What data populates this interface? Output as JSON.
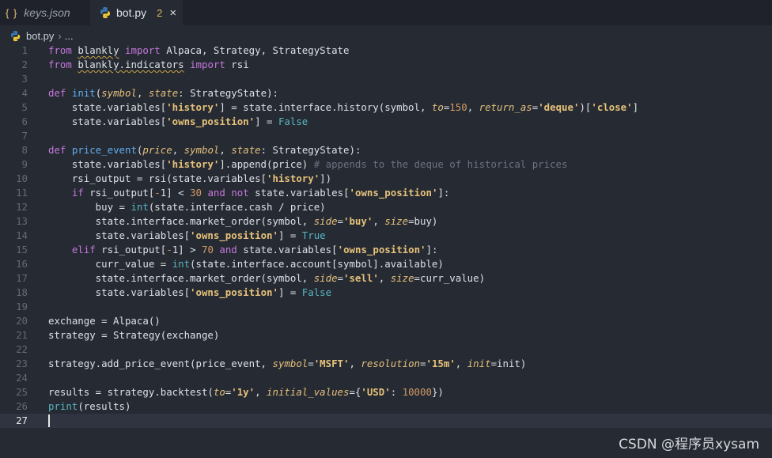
{
  "tabs": [
    {
      "icon": "json-braces-icon",
      "icon_text": "{ }",
      "label": "keys.json"
    },
    {
      "icon": "python-icon",
      "label": "bot.py",
      "badge": "2",
      "close": "×"
    }
  ],
  "breadcrumb": {
    "file": "bot.py",
    "separator": "›",
    "more": "..."
  },
  "colors": {
    "background": "#262a33",
    "keyword": "#c678dd",
    "function": "#61afef",
    "param": "#e5c07b",
    "number": "#d19a66",
    "comment": "#6b7280"
  },
  "editor": {
    "active_line": 27,
    "lines": [
      [
        [
          "from",
          "k"
        ],
        [
          " "
        ],
        [
          "blankly",
          "sq"
        ],
        [
          " "
        ],
        [
          "import",
          "k"
        ],
        [
          " Alpaca, Strategy, StrategyState"
        ]
      ],
      [
        [
          "from",
          "k"
        ],
        [
          " "
        ],
        [
          "blankly.indicators",
          "sq"
        ],
        [
          " "
        ],
        [
          "import",
          "k"
        ],
        [
          " rsi"
        ]
      ],
      [],
      [
        [
          "def",
          "k"
        ],
        [
          " "
        ],
        [
          "init",
          "f"
        ],
        [
          "("
        ],
        [
          "symbol",
          "p"
        ],
        [
          ", "
        ],
        [
          "state",
          "p"
        ],
        [
          ": StrategyState):"
        ]
      ],
      [
        [
          "    state.variables["
        ],
        [
          "'history'",
          "s"
        ],
        [
          "] = state.interface.history(symbol, "
        ],
        [
          "to",
          "p"
        ],
        [
          "="
        ],
        [
          "150",
          "n"
        ],
        [
          ", "
        ],
        [
          "return_as",
          "p"
        ],
        [
          "="
        ],
        [
          "'deque'",
          "s"
        ],
        [
          ")["
        ],
        [
          "'close'",
          "s"
        ],
        [
          "]"
        ]
      ],
      [
        [
          "    state.variables["
        ],
        [
          "'owns_position'",
          "s"
        ],
        [
          "] = "
        ],
        [
          "False",
          "b"
        ]
      ],
      [],
      [
        [
          "def",
          "k"
        ],
        [
          " "
        ],
        [
          "price_event",
          "f"
        ],
        [
          "("
        ],
        [
          "price",
          "p"
        ],
        [
          ", "
        ],
        [
          "symbol",
          "p"
        ],
        [
          ", "
        ],
        [
          "state",
          "p"
        ],
        [
          ": StrategyState):"
        ]
      ],
      [
        [
          "    state.variables["
        ],
        [
          "'history'",
          "s"
        ],
        [
          "].append(price) "
        ],
        [
          "# appends to the deque of historical prices",
          "c"
        ]
      ],
      [
        [
          "    rsi_output = rsi(state.variables["
        ],
        [
          "'history'",
          "s"
        ],
        [
          "])"
        ]
      ],
      [
        [
          "    "
        ],
        [
          "if",
          "k"
        ],
        [
          " rsi_output["
        ],
        [
          "-",
          "n"
        ],
        [
          "1] < "
        ],
        [
          "30",
          "n"
        ],
        [
          " "
        ],
        [
          "and",
          "k"
        ],
        [
          " "
        ],
        [
          "not",
          "k"
        ],
        [
          " state.variables["
        ],
        [
          "'owns_position'",
          "s"
        ],
        [
          "]:"
        ]
      ],
      [
        [
          "        buy = "
        ],
        [
          "int",
          "b"
        ],
        [
          "(state.interface.cash / price)"
        ]
      ],
      [
        [
          "        state.interface.market_order(symbol, "
        ],
        [
          "side",
          "p"
        ],
        [
          "="
        ],
        [
          "'buy'",
          "s"
        ],
        [
          ", "
        ],
        [
          "size",
          "p"
        ],
        [
          "=buy)"
        ]
      ],
      [
        [
          "        state.variables["
        ],
        [
          "'owns_position'",
          "s"
        ],
        [
          "] = "
        ],
        [
          "True",
          "b"
        ]
      ],
      [
        [
          "    "
        ],
        [
          "elif",
          "k"
        ],
        [
          " rsi_output["
        ],
        [
          "-",
          "n"
        ],
        [
          "1] > "
        ],
        [
          "70",
          "n"
        ],
        [
          " "
        ],
        [
          "and",
          "k"
        ],
        [
          " state.variables["
        ],
        [
          "'owns_position'",
          "s"
        ],
        [
          "]:"
        ]
      ],
      [
        [
          "        curr_value = "
        ],
        [
          "int",
          "b"
        ],
        [
          "(state.interface.account[symbol].available)"
        ]
      ],
      [
        [
          "        state.interface.market_order(symbol, "
        ],
        [
          "side",
          "p"
        ],
        [
          "="
        ],
        [
          "'sell'",
          "s"
        ],
        [
          ", "
        ],
        [
          "size",
          "p"
        ],
        [
          "=curr_value)"
        ]
      ],
      [
        [
          "        state.variables["
        ],
        [
          "'owns_position'",
          "s"
        ],
        [
          "] = "
        ],
        [
          "False",
          "b"
        ]
      ],
      [],
      [
        [
          "exchange = Alpaca()"
        ]
      ],
      [
        [
          "strategy = Strategy(exchange)"
        ]
      ],
      [],
      [
        [
          "strategy.add_price_event(price_event, "
        ],
        [
          "symbol",
          "p"
        ],
        [
          "="
        ],
        [
          "'MSFT'",
          "s"
        ],
        [
          ", "
        ],
        [
          "resolution",
          "p"
        ],
        [
          "="
        ],
        [
          "'15m'",
          "s"
        ],
        [
          ", "
        ],
        [
          "init",
          "p"
        ],
        [
          "=init)"
        ]
      ],
      [],
      [
        [
          "results = strategy.backtest("
        ],
        [
          "to",
          "p"
        ],
        [
          "="
        ],
        [
          "'1y'",
          "s"
        ],
        [
          ", "
        ],
        [
          "initial_values",
          "p"
        ],
        [
          "={"
        ],
        [
          "'USD'",
          "s"
        ],
        [
          ": "
        ],
        [
          "10000",
          "n"
        ],
        [
          "})"
        ]
      ],
      [
        [
          "print",
          "b"
        ],
        [
          "(results)"
        ]
      ],
      []
    ]
  },
  "watermark": "CSDN @程序员xysam"
}
